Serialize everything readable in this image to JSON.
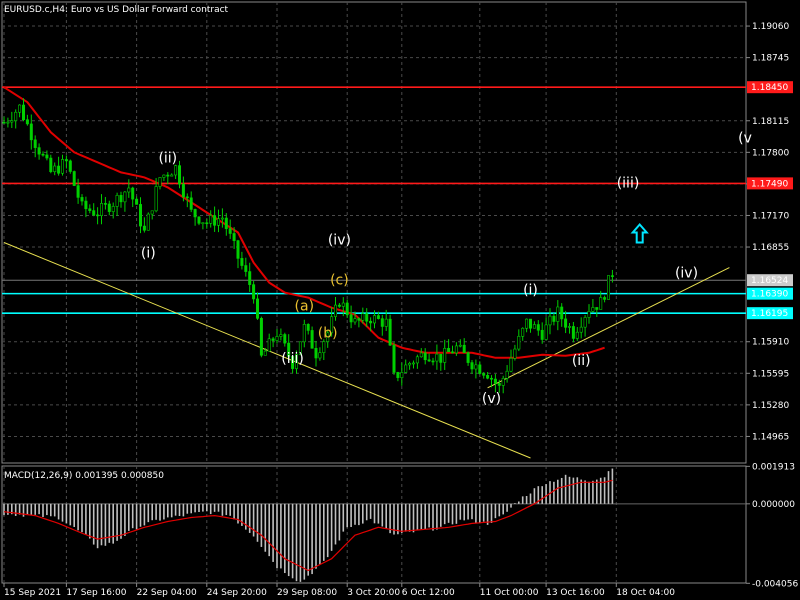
{
  "header": {
    "title": "EURUSD.c,H4:  Euro vs US Dollar Forward contract",
    "macd_label": "MACD(12,26,9) 0.001395 0.000850"
  },
  "colors": {
    "background": "#000000",
    "grid": "#4a4a4a",
    "candles": "#00d000",
    "ma": "#e00000",
    "trendline": "#e8e050",
    "resistance": "#ff1a1a",
    "support": "#00ffff",
    "macd_hist": "#c0c0c0",
    "macd_signal": "#e00000",
    "wave_white": "#ffffff",
    "wave_yellow": "#e8c030",
    "arrow": "#00e5ff"
  },
  "chart_data": {
    "type": "candlestick",
    "symbol": "EURUSD.c",
    "timeframe": "H4",
    "ylim": [
      1.147,
      1.193
    ],
    "y_ticks": [
      "1.19060",
      "1.18745",
      "1.18450",
      "1.18115",
      "1.17800",
      "1.17485",
      "1.17170",
      "1.16855",
      "1.16524",
      "1.16390",
      "1.16195",
      "1.15910",
      "1.15595",
      "1.15280",
      "1.14965"
    ],
    "x_ticks": [
      "15 Sep 2021",
      "17 Sep 16:00",
      "22 Sep 04:00",
      "24 Sep 20:00",
      "29 Sep 08:00",
      "3 Oct 20:00",
      "6 Oct 12:00",
      "11 Oct 00:00",
      "13 Oct 16:00",
      "18 Oct 04:00"
    ],
    "price_path": [
      [
        0,
        1.181
      ],
      [
        4,
        1.1825
      ],
      [
        8,
        1.179
      ],
      [
        12,
        1.176
      ],
      [
        16,
        1.177
      ],
      [
        20,
        1.1725
      ],
      [
        24,
        1.172
      ],
      [
        28,
        1.173
      ],
      [
        32,
        1.1745
      ],
      [
        36,
        1.17
      ],
      [
        40,
        1.1755
      ],
      [
        44,
        1.1765
      ],
      [
        48,
        1.172
      ],
      [
        52,
        1.171
      ],
      [
        56,
        1.1715
      ],
      [
        60,
        1.1675
      ],
      [
        64,
        1.164
      ],
      [
        66,
        1.1575
      ],
      [
        70,
        1.16
      ],
      [
        74,
        1.157
      ],
      [
        77,
        1.1605
      ],
      [
        80,
        1.158
      ],
      [
        83,
        1.16
      ],
      [
        86,
        1.1632
      ],
      [
        90,
        1.161
      ],
      [
        94,
        1.1615
      ],
      [
        98,
        1.161
      ],
      [
        100,
        1.1555
      ],
      [
        104,
        1.157
      ],
      [
        108,
        1.158
      ],
      [
        112,
        1.1575
      ],
      [
        116,
        1.1585
      ],
      [
        120,
        1.157
      ],
      [
        124,
        1.156
      ],
      [
        127,
        1.1545
      ],
      [
        130,
        1.1575
      ],
      [
        134,
        1.161
      ],
      [
        138,
        1.16
      ],
      [
        142,
        1.162
      ],
      [
        146,
        1.16
      ],
      [
        150,
        1.1625
      ],
      [
        153,
        1.163
      ],
      [
        156,
        1.166
      ]
    ],
    "ma": {
      "name": "",
      "points": [
        [
          0,
          1.1845
        ],
        [
          6,
          1.183
        ],
        [
          12,
          1.18
        ],
        [
          18,
          1.178
        ],
        [
          24,
          1.177
        ],
        [
          30,
          1.176
        ],
        [
          36,
          1.1755
        ],
        [
          42,
          1.1745
        ],
        [
          48,
          1.173
        ],
        [
          54,
          1.1715
        ],
        [
          60,
          1.17
        ],
        [
          64,
          1.167
        ],
        [
          68,
          1.165
        ],
        [
          72,
          1.164
        ],
        [
          78,
          1.1635
        ],
        [
          84,
          1.1625
        ],
        [
          90,
          1.1618
        ],
        [
          96,
          1.1595
        ],
        [
          102,
          1.1585
        ],
        [
          108,
          1.158
        ],
        [
          114,
          1.158
        ],
        [
          120,
          1.158
        ],
        [
          126,
          1.1575
        ],
        [
          132,
          1.1575
        ],
        [
          138,
          1.1578
        ],
        [
          144,
          1.1577
        ],
        [
          150,
          1.158
        ],
        [
          154,
          1.1585
        ]
      ]
    },
    "horizontal_lines": [
      {
        "price": 1.1845,
        "label": "1.18450",
        "kind": "resistance"
      },
      {
        "price": 1.1749,
        "label": "1.17490",
        "kind": "resistance"
      },
      {
        "price": 1.1639,
        "label": "1.16390",
        "kind": "support"
      },
      {
        "price": 1.16195,
        "label": "1.16195",
        "kind": "support"
      }
    ],
    "current_price": {
      "price": 1.16524,
      "label": "1.16524"
    },
    "trendlines": [
      {
        "from": [
          0,
          1.169
        ],
        "to": [
          135,
          1.1475
        ]
      },
      {
        "from": [
          124,
          1.1545
        ],
        "to": [
          186,
          1.1665
        ]
      }
    ],
    "wave_labels": [
      {
        "text": "(ii)",
        "bar": 42,
        "price": 1.177,
        "color": "white"
      },
      {
        "text": "(i)",
        "bar": 37,
        "price": 1.1675,
        "color": "white"
      },
      {
        "text": "(iv)",
        "bar": 86,
        "price": 1.1688,
        "color": "white"
      },
      {
        "text": "(c)",
        "bar": 86,
        "price": 1.1648,
        "color": "yellow"
      },
      {
        "text": "(a)",
        "bar": 77,
        "price": 1.1622,
        "color": "yellow"
      },
      {
        "text": "(b)",
        "bar": 83,
        "price": 1.1595,
        "color": "yellow"
      },
      {
        "text": "(iii)",
        "bar": 74,
        "price": 1.157,
        "color": "white"
      },
      {
        "text": "(v)",
        "bar": 125,
        "price": 1.153,
        "color": "white"
      },
      {
        "text": "(i)",
        "bar": 135,
        "price": 1.1638,
        "color": "white"
      },
      {
        "text": "(ii)",
        "bar": 148,
        "price": 1.1568,
        "color": "white"
      },
      {
        "text": "(iii)",
        "bar": 160,
        "price": 1.1745,
        "color": "white"
      },
      {
        "text": "(iv)",
        "bar": 175,
        "price": 1.1655,
        "color": "white"
      },
      {
        "text": "(v",
        "bar": 190,
        "price": 1.179,
        "color": "white"
      }
    ],
    "arrow": {
      "bar": 163,
      "price": 1.17,
      "direction": "up"
    },
    "macd": {
      "ylim": [
        -0.00404,
        0.00193
      ],
      "ticks": [
        "0.001913",
        "0.000000",
        "-0.004056"
      ],
      "hist_path": [
        [
          0,
          -0.0005
        ],
        [
          8,
          -0.0006
        ],
        [
          14,
          -0.0007
        ],
        [
          20,
          -0.0015
        ],
        [
          24,
          -0.0022
        ],
        [
          28,
          -0.002
        ],
        [
          34,
          -0.0012
        ],
        [
          40,
          -0.0008
        ],
        [
          46,
          -0.0006
        ],
        [
          52,
          -0.0004
        ],
        [
          58,
          -0.0006
        ],
        [
          64,
          -0.0016
        ],
        [
          70,
          -0.0032
        ],
        [
          76,
          -0.004
        ],
        [
          82,
          -0.003
        ],
        [
          88,
          -0.0012
        ],
        [
          94,
          -0.0008
        ],
        [
          100,
          -0.0016
        ],
        [
          106,
          -0.0014
        ],
        [
          112,
          -0.0012
        ],
        [
          118,
          -0.0008
        ],
        [
          124,
          -0.001
        ],
        [
          128,
          -0.0006
        ],
        [
          132,
          0.0002
        ],
        [
          138,
          0.001
        ],
        [
          144,
          0.0014
        ],
        [
          150,
          0.0012
        ],
        [
          154,
          0.0014
        ],
        [
          156,
          0.0019
        ]
      ],
      "signal_path": [
        [
          0,
          -0.0004
        ],
        [
          8,
          -0.0006
        ],
        [
          14,
          -0.001
        ],
        [
          20,
          -0.0015
        ],
        [
          24,
          -0.0018
        ],
        [
          30,
          -0.0016
        ],
        [
          36,
          -0.0012
        ],
        [
          42,
          -0.0009
        ],
        [
          48,
          -0.0007
        ],
        [
          54,
          -0.0006
        ],
        [
          60,
          -0.0008
        ],
        [
          66,
          -0.0016
        ],
        [
          72,
          -0.0028
        ],
        [
          78,
          -0.0034
        ],
        [
          84,
          -0.0028
        ],
        [
          90,
          -0.0016
        ],
        [
          96,
          -0.0012
        ],
        [
          102,
          -0.0014
        ],
        [
          108,
          -0.0013
        ],
        [
          114,
          -0.0012
        ],
        [
          120,
          -0.001
        ],
        [
          126,
          -0.0009
        ],
        [
          130,
          -0.0006
        ],
        [
          136,
          0.0
        ],
        [
          142,
          0.0008
        ],
        [
          148,
          0.0011
        ],
        [
          154,
          0.0011
        ],
        [
          156,
          0.0012
        ]
      ]
    }
  }
}
